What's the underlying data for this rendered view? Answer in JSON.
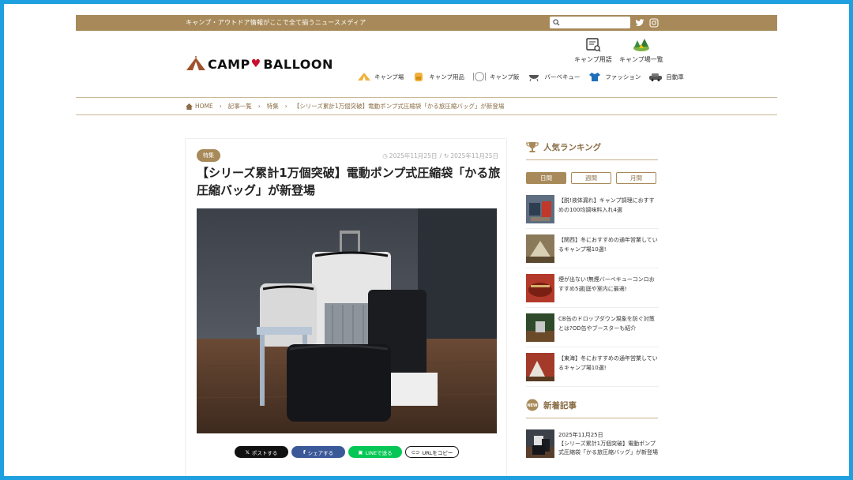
{
  "topbar": {
    "tagline": "キャンプ・アウトドア情報がここで全て揃うニュースメディア",
    "search_placeholder": "",
    "twitter_icon": "twitter-icon",
    "instagram_icon": "instagram-icon"
  },
  "header": {
    "logo_left": "CAMP",
    "logo_right": "BALLOON",
    "util": [
      {
        "label": "キャンプ用語",
        "icon": "glossary-book-icon"
      },
      {
        "label": "キャンプ場一覧",
        "icon": "campsite-map-icon"
      }
    ],
    "nav": [
      {
        "label": "キャンプ場",
        "icon": "tent-icon"
      },
      {
        "label": "キャンプ用品",
        "icon": "backpack-icon"
      },
      {
        "label": "キャンプ飯",
        "icon": "plate-icon"
      },
      {
        "label": "バーベキュー",
        "icon": "grill-icon"
      },
      {
        "label": "ファッション",
        "icon": "clothes-icon"
      },
      {
        "label": "自動車",
        "icon": "car-icon"
      }
    ]
  },
  "breadcrumb": {
    "items": [
      "HOME",
      "記事一覧",
      "特集",
      "【シリーズ累計1万個突破】電動ポンプ式圧縮袋「かる旅圧縮バッグ」が新登場"
    ]
  },
  "article": {
    "badge": "特集",
    "published": "2025年11月25日",
    "updated": "2025年11月25日",
    "title": "【シリーズ累計1万個突破】電動ポンプ式圧縮袋「かる旅圧縮バッグ」が新登場",
    "share": [
      {
        "label": "ポストする",
        "color": "#111111"
      },
      {
        "label": "シェアする",
        "color": "#3b5998"
      },
      {
        "label": "LINEで送る",
        "color": "#06c755"
      },
      {
        "label": "URLをコピー",
        "color": "#ffffff"
      }
    ]
  },
  "sidebar": {
    "ranking_title": "人気ランキング",
    "tabs": [
      "日間",
      "週間",
      "月間"
    ],
    "active_tab": "日間",
    "ranking": [
      {
        "text": "【脱!液体漏れ】キャンプ調理におすすめの100均調味料入れ4選"
      },
      {
        "text": "【関西】冬におすすめの通年営業しているキャンプ場10選!"
      },
      {
        "text": "煙が出ない!無煙バーベキューコンロおすすめ5選|庭や室内に最適!"
      },
      {
        "text": "CB缶のドロップダウン現象を防ぐ対策とは?OD缶やブースターも紹介"
      },
      {
        "text": "【東海】冬におすすめの通年営業しているキャンプ場10選!"
      }
    ],
    "new_title": "新着記事",
    "new_items": [
      {
        "date": "2025年11月25日",
        "text": "【シリーズ累計1万個突破】電動ポンプ式圧縮袋「かる旅圧縮バッグ」が新登場"
      }
    ]
  },
  "colors": {
    "accent": "#a88a5a",
    "frame": "#1ea0e0"
  }
}
